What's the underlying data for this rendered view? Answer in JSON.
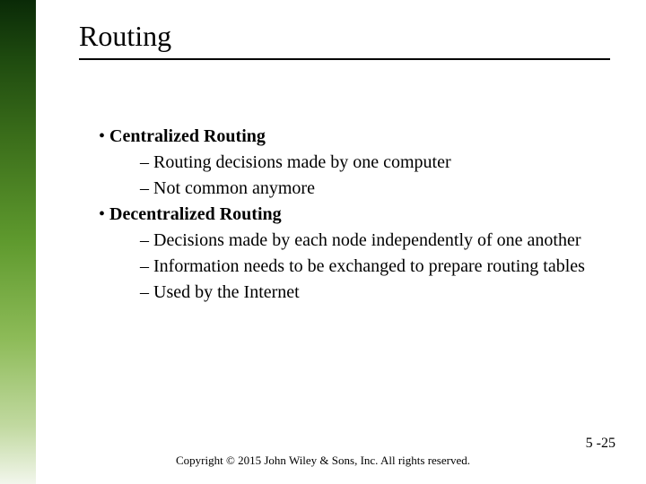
{
  "title": "Routing",
  "bullets": {
    "b1": "Centralized Routing",
    "b1s1": "Routing decisions made by one computer",
    "b1s2": "Not common anymore",
    "b2": "Decentralized Routing",
    "b2s1": "Decisions made by each node independently of one another",
    "b2s2": "Information needs to be exchanged to prepare routing tables",
    "b2s3": "Used by the Internet"
  },
  "footer": "Copyright © 2015 John Wiley & Sons, Inc. All rights reserved.",
  "page_number": "5 -25"
}
